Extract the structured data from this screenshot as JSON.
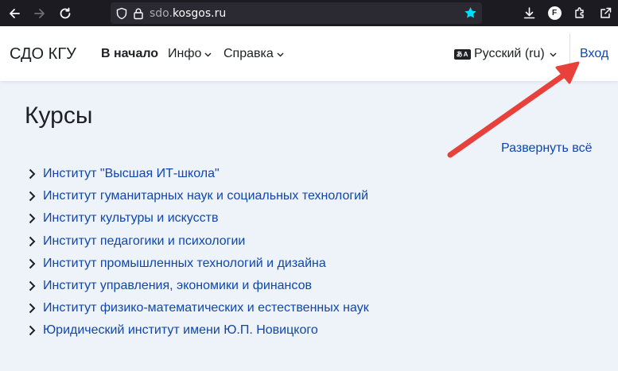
{
  "browser": {
    "url_domain": "sdo.",
    "url_host": "kosgos.ru",
    "profile_letter": "F"
  },
  "header": {
    "brand": "СДО КГУ",
    "home": "В начало",
    "info": "Инфо",
    "help": "Справка",
    "language": "Русский (ru)",
    "language_icon": "あA",
    "login": "Вход"
  },
  "main": {
    "title": "Курсы",
    "expand_all": "Развернуть всё",
    "categories": [
      "Институт \"Высшая ИТ-школа\"",
      "Институт гуманитарных наук и социальных технологий",
      "Институт культуры и искусств",
      "Институт педагогики и психологии",
      "Институт промышленных технологий и дизайна",
      "Институт управления, экономики и финансов",
      "Институт физико-математических и естественных наук",
      "Юридический институт имени Ю.П. Новицкого"
    ]
  },
  "colors": {
    "link": "#0f47ad",
    "page_bg": "#eef2f9",
    "annotation_arrow": "#e8403a"
  },
  "icons": {
    "back": "back-arrow-icon",
    "forward": "forward-arrow-icon",
    "reload": "reload-icon",
    "shield": "tracking-shield-icon",
    "lock": "lock-icon",
    "bookmark": "bookmark-star-icon",
    "download": "download-icon",
    "extensions": "puzzle-icon",
    "overflow": "open-external-icon",
    "caret": "chevron-right-icon"
  }
}
